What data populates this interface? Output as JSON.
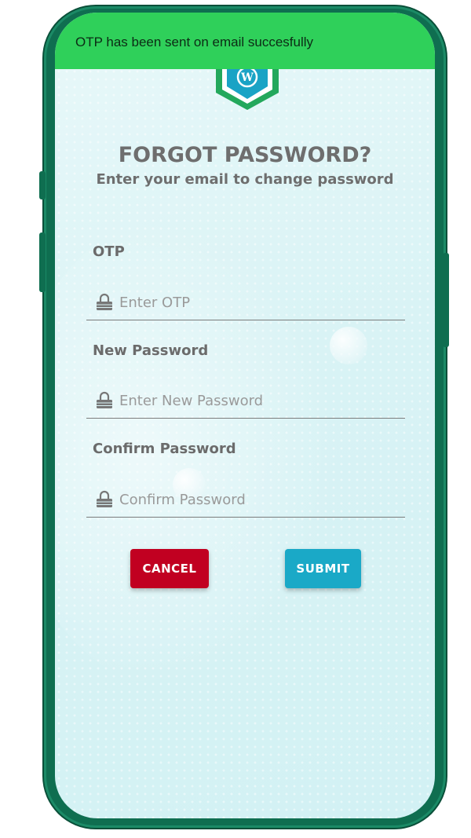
{
  "toast": {
    "message": "OTP has been sent on email succesfully"
  },
  "header": {
    "title": "FORGOT PASSWORD?",
    "subtitle": "Enter your email to change password"
  },
  "fields": [
    {
      "label": "OTP",
      "placeholder": "Enter OTP",
      "value": ""
    },
    {
      "label": "New Password",
      "placeholder": "Enter New Password",
      "value": ""
    },
    {
      "label": "Confirm Password",
      "placeholder": "Confirm Password",
      "value": ""
    }
  ],
  "buttons": {
    "cancel_label": "CANCEL",
    "submit_label": "SUBMIT"
  },
  "icons": {
    "logo": "shield-logo-icon",
    "field_icon": "lock-icon"
  },
  "colors": {
    "toast_bg": "#2fd05a",
    "cancel_bg": "#c10021",
    "submit_bg": "#1aa9c7",
    "frame": "#0f6e50"
  }
}
